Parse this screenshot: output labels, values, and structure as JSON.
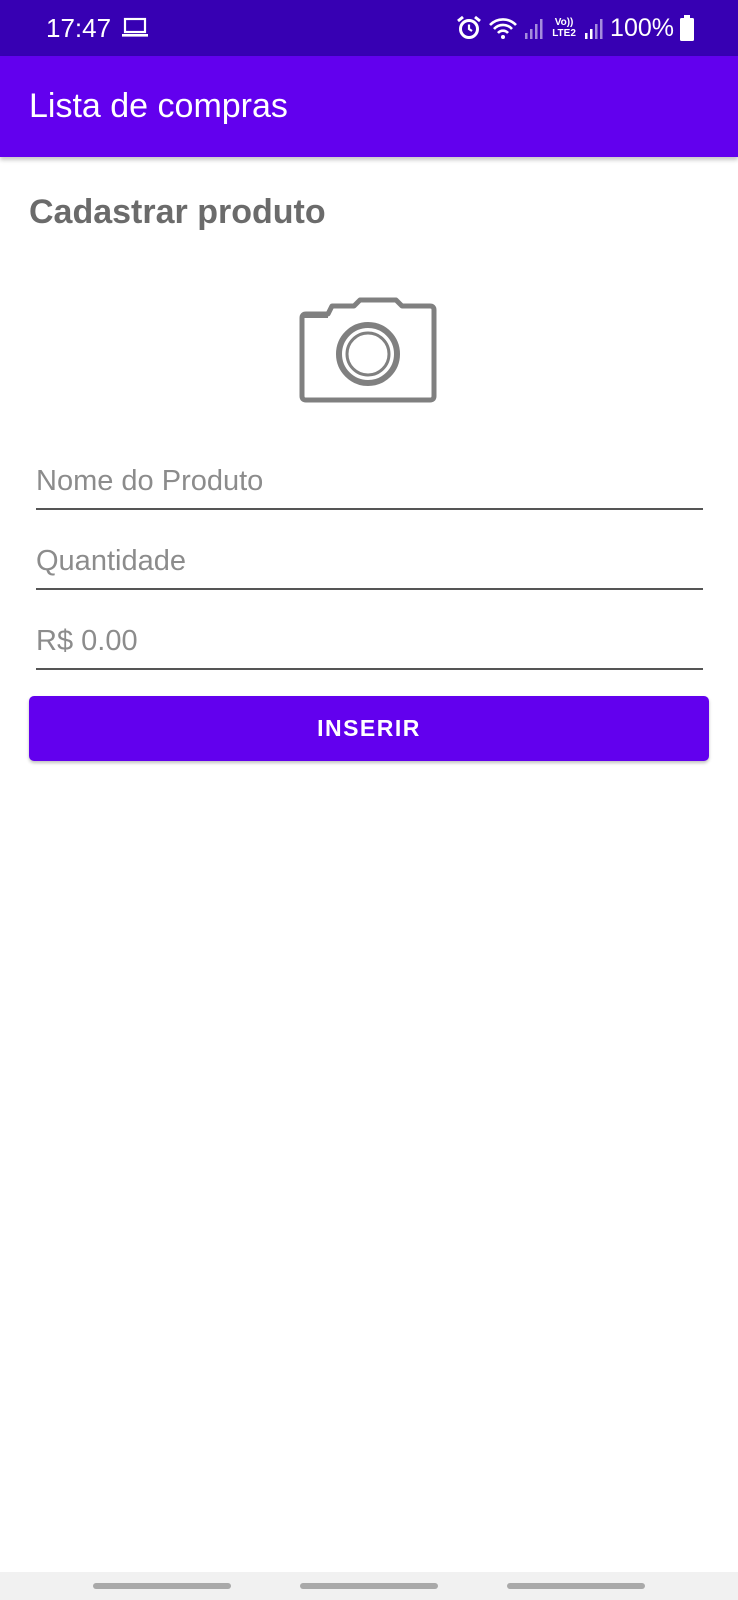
{
  "status_bar": {
    "time": "17:47",
    "volte_top": "Vo))",
    "volte_bottom": "LTE2",
    "battery": "100%",
    "color": "#3700b3",
    "icons": [
      "laptop-icon",
      "alarm-icon",
      "wifi-icon",
      "signal-icon",
      "volte-icon",
      "signal-icon",
      "battery-icon"
    ]
  },
  "app_bar": {
    "title": "Lista de compras",
    "color": "#6200ee"
  },
  "form": {
    "heading": "Cadastrar produto",
    "image_icon": "camera-icon",
    "name_placeholder": "Nome do Produto",
    "name_value": "",
    "quantity_placeholder": "Quantidade",
    "quantity_value": "",
    "price_placeholder": "R$ 0.00",
    "price_value": "",
    "submit_label": "INSERIR"
  },
  "nav_bar": {
    "buttons": [
      "recents",
      "home",
      "back"
    ]
  }
}
